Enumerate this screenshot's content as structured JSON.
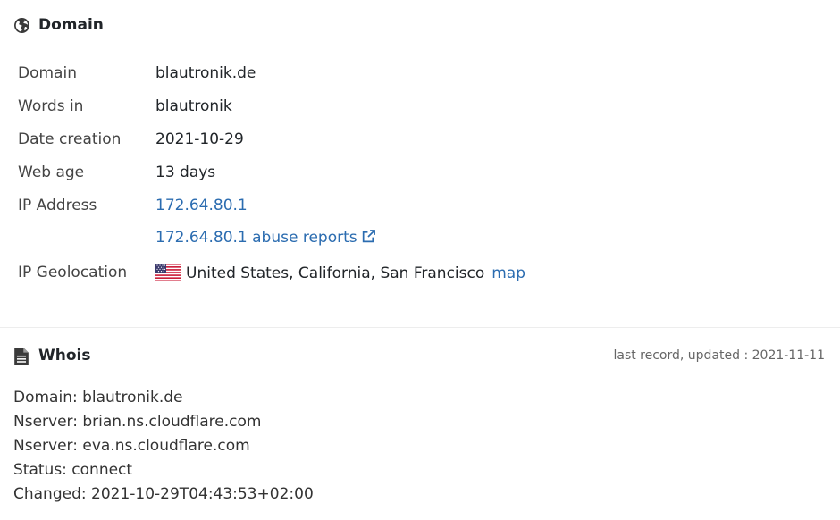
{
  "domain_section": {
    "title": "Domain",
    "icon": "globe-icon",
    "rows": {
      "domain": {
        "label": "Domain",
        "value": "blautronik.de"
      },
      "words": {
        "label": "Words in",
        "value": "blautronik"
      },
      "date_creation": {
        "label": "Date creation",
        "value": "2021-10-29"
      },
      "web_age": {
        "label": "Web age",
        "value": "13 days"
      },
      "ip_address": {
        "label": "IP Address",
        "value": "172.64.80.1",
        "abuse_link": "172.64.80.1 abuse reports"
      },
      "geolocation": {
        "label": "IP Geolocation",
        "value": "United States, California, San Francisco",
        "map_link": "map",
        "flag": "us-flag-icon"
      }
    }
  },
  "whois_section": {
    "title": "Whois",
    "icon": "document-icon",
    "last_record": "last record, updated : 2021-11-11",
    "lines": [
      "Domain: blautronik.de",
      "Nserver: brian.ns.cloudflare.com",
      "Nserver: eva.ns.cloudflare.com",
      "Status: connect",
      "Changed: 2021-10-29T04:43:53+02:00"
    ]
  },
  "colors": {
    "link": "#2b6cb0",
    "text": "#212529",
    "muted": "#666666"
  }
}
